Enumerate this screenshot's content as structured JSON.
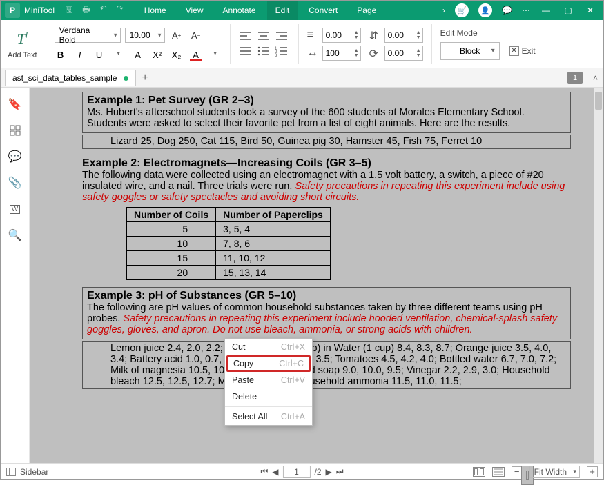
{
  "app": {
    "name": "MiniTool"
  },
  "menus": [
    "Home",
    "View",
    "Annotate",
    "Edit",
    "Convert",
    "Page"
  ],
  "ribbon": {
    "addtext_label": "Add Text",
    "font_family": "Verdana Bold",
    "font_size": "10.00",
    "spacing_a": "0.00",
    "spacing_b": "0.00",
    "scale": "100",
    "rotate": "0.00",
    "edit_mode_label": "Edit Mode",
    "block_label": "Block",
    "exit_label": "Exit"
  },
  "tab": {
    "name": "ast_sci_data_tables_sample",
    "page_badge": "1"
  },
  "context_menu": {
    "items": [
      {
        "label": "Cut",
        "shortcut": "Ctrl+X"
      },
      {
        "label": "Copy",
        "shortcut": "Ctrl+C",
        "highlight": true
      },
      {
        "label": "Paste",
        "shortcut": "Ctrl+V"
      },
      {
        "label": "Delete",
        "shortcut": ""
      },
      {
        "label": "Select All",
        "shortcut": "Ctrl+A"
      }
    ]
  },
  "doc": {
    "ex1_title": "Example 1: Pet Survey (GR 2–3)",
    "ex1_body": "Ms. Hubert's afterschool students took a survey of the 600 students at Morales Elementary School. Students were asked to select their favorite pet from a list of eight animals. Here are the results.",
    "ex1_results": "Lizard 25, Dog 250, Cat 115, Bird 50, Guinea pig 30, Hamster 45, Fish 75, Ferret 10",
    "ex2_title": "Example 2: Electromagnets—Increasing Coils (GR 3–5)",
    "ex2_body_plain": "The following data were collected using an electromagnet with a 1.5 volt battery, a switch, a piece of #20 insulated wire, and a nail. Three trials were run. ",
    "ex2_body_red": "Safety precautions in repeating this experiment include using safety goggles or safety spectacles and avoiding short circuits.",
    "table_h1": "Number of Coils",
    "table_h2": "Number of Paperclips",
    "table_rows": [
      {
        "coils": "5",
        "clips": "3, 5, 4"
      },
      {
        "coils": "10",
        "clips": "7, 8, 6"
      },
      {
        "coils": "15",
        "clips": "11, 10, 12"
      },
      {
        "coils": "20",
        "clips": "15, 13, 14"
      }
    ],
    "ex3_title": "Example 3: pH of Substances (GR 5–10)",
    "ex3_body_plain": "The following are pH values of common household substances taken by three different teams using pH probes. ",
    "ex3_body_red": "Safety precautions in repeating this experiment include hooded ventilation, chemical-splash safety goggles, gloves, and apron. Do not use bleach, ammonia, or strong acids with children.",
    "ex3_results": "Lemon juice 2.4, 2.0, 2.2; Baking soda (1 Tbsp) in Water (1 cup) 8.4, 8.3, 8.7; Orange juice 3.5, 4.0, 3.4; Battery acid 1.0, 0.7, 0.5; Apples 3.0, 3.2, 3.5; Tomatoes 4.5, 4.2, 4.0; Bottled water 6.7, 7.0, 7.2; Milk of magnesia 10.5, 10.3, 10.6; Liquid hand soap 9.0, 10.0, 9.5; Vinegar 2.2, 2.9, 3.0; Household bleach 12.5, 12.5, 12.7; Milk 6.6, 6.5, 6.4; Household ammonia 11.5, 11.0, 11.5;"
  },
  "status": {
    "sidebar_label": "Sidebar",
    "page_current": "1",
    "page_total": "/2",
    "zoom_label": "Fit Width"
  }
}
